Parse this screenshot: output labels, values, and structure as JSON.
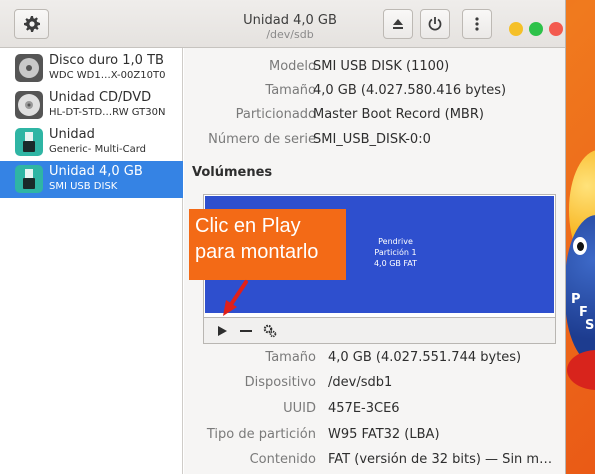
{
  "window": {
    "title": "Unidad 4,0 GB",
    "subtitle": "/dev/sdb"
  },
  "colors": {
    "accent": "#3583e4",
    "partition": "#2e4fce",
    "callout": "#f36a16",
    "close": "#f35a4f",
    "maximize": "#2dc24a",
    "minimize": "#f5c028"
  },
  "icons": {
    "menu": "gear-icon",
    "eject": "eject-icon",
    "power": "power-icon",
    "more": "kebab-menu-icon",
    "play": "play-icon",
    "minus": "minus-icon",
    "settings": "gears-icon"
  },
  "devices": [
    {
      "name": "Disco duro 1,0 TB",
      "model": "WDC WD1…X-00Z10T0",
      "icon": "harddisk-icon",
      "selected": false
    },
    {
      "name": "Unidad CD/DVD",
      "model": "HL-DT-STD…RW GT30N",
      "icon": "optical-disc-icon",
      "selected": false
    },
    {
      "name": "Unidad",
      "model": "Generic- Multi-Card",
      "icon": "usb-drive-icon",
      "selected": false
    },
    {
      "name": "Unidad 4,0 GB",
      "model": "SMI USB DISK",
      "icon": "usb-drive-icon",
      "selected": true
    }
  ],
  "drive": {
    "model_label": "Modelo",
    "model": "SMI USB DISK (1100)",
    "size_label": "Tamaño",
    "size": "4,0 GB (4.027.580.416 bytes)",
    "partitioning_label": "Particionado",
    "partitioning": "Master Boot Record (MBR)",
    "serial_label": "Número de serie",
    "serial": "SMI_USB_DISK-0:0"
  },
  "volumes": {
    "heading": "Volúmenes",
    "partition_line1": "Pendrive",
    "partition_line2": "Partición 1",
    "partition_line3": "4,0 GB FAT"
  },
  "partition": {
    "size_label": "Tamaño",
    "size": "4,0 GB (4.027.551.744 bytes)",
    "device_label": "Dispositivo",
    "device": "/dev/sdb1",
    "uuid_label": "UUID",
    "uuid": "457E-3CE6",
    "type_label": "Tipo de partición",
    "type": "W95 FAT32 (LBA)",
    "content_label": "Contenido",
    "content": "FAT (versión de 32 bits) — Sin m…"
  },
  "callout": {
    "line1": "Clic en Play",
    "line2": "para montarlo"
  },
  "wallpaper": {
    "letter1": "P",
    "letter2": "F",
    "letter3": "S"
  }
}
